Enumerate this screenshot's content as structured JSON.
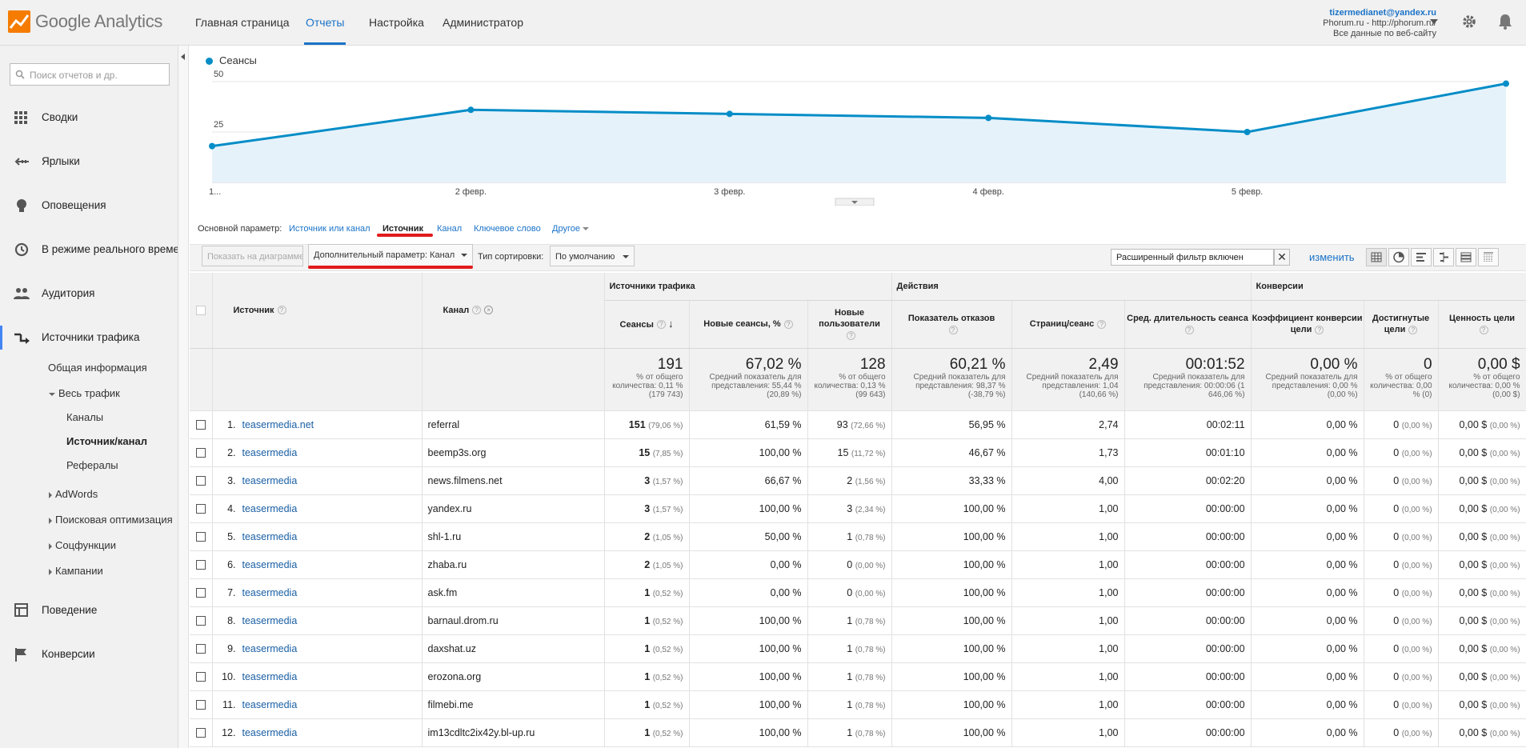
{
  "header": {
    "brand_google": "Google",
    "brand_analytics": "Analytics",
    "nav": [
      "Главная страница",
      "Отчеты",
      "Настройка",
      "Администратор"
    ],
    "active_nav": "Отчеты",
    "account_email": "tizermedianet@yandex.ru",
    "account_property": "Phorum.ru - http://phorum.ru/",
    "account_view": "Все данные по веб-сайту"
  },
  "sidebar": {
    "search_placeholder": "Поиск отчетов и др.",
    "items": [
      {
        "label": "Сводки",
        "icon": "grid-icon"
      },
      {
        "label": "Ярлыки",
        "icon": "shortcut-arrow-icon"
      },
      {
        "label": "Оповещения",
        "icon": "lightbulb-icon"
      },
      {
        "label": "В режиме реального времени",
        "icon": "clock-icon"
      },
      {
        "label": "Аудитория",
        "icon": "people-icon"
      },
      {
        "label": "Источники трафика",
        "icon": "traffic-arrows-icon"
      },
      {
        "label": "Поведение",
        "icon": "behavior-layout-icon"
      },
      {
        "label": "Конверсии",
        "icon": "flag-icon"
      }
    ],
    "sub": {
      "overview": "Общая информация",
      "all_traffic": "Весь трафик",
      "channels": "Каналы",
      "source_medium": "Источник/канал",
      "referrals": "Рефералы",
      "adwords": "AdWords",
      "seo": "Поисковая оптимизация",
      "social": "Соцфункции",
      "campaigns": "Кампании"
    }
  },
  "chart_data": {
    "type": "area",
    "series": [
      {
        "name": "Сеансы",
        "values": [
          18,
          36,
          34,
          32,
          25,
          49
        ]
      }
    ],
    "x": [
      "1...",
      "2 февр.",
      "3 февр.",
      "4 февр.",
      "5 февр.",
      ""
    ],
    "y_ticks": [
      "50",
      "25"
    ],
    "ylim": [
      0,
      50
    ],
    "color": "#058dc7"
  },
  "dimensions": {
    "label": "Основной параметр:",
    "options": [
      "Источник или канал",
      "Источник",
      "Канал",
      "Ключевое слово",
      "Другое"
    ],
    "active": "Источник"
  },
  "toolbar": {
    "plot_rows": "Показать на диаграмме",
    "secondary": "Дополнительный параметр: Канал",
    "sort_label": "Тип сортировки:",
    "sort_value": "По умолчанию",
    "filter_text": "Расширенный фильтр включен",
    "filter_clear": "✕",
    "change": "изменить"
  },
  "table": {
    "groups": {
      "traffic": "Источники трафика",
      "actions": "Действия",
      "conversions": "Конверсии"
    },
    "columns": {
      "source": "Источник",
      "medium": "Канал",
      "sessions": "Сеансы",
      "new_sessions": "Новые сеансы, %",
      "new_users": "Новые пользователи",
      "bounce": "Показатель отказов",
      "pages": "Страниц/сеанс",
      "duration": "Сред. длительность сеанса",
      "conv_rate": "Коэффициент конверсии цели",
      "completions": "Достигнутые цели",
      "value": "Ценность цели"
    },
    "totals": {
      "sessions": "191",
      "sessions_note": "% от общего количества: 0,11 % (179 743)",
      "new_sessions": "67,02 %",
      "new_sessions_note": "Средний показатель для представления: 55,44 % (20,89 %)",
      "new_users": "128",
      "new_users_note": "% от общего количества: 0,13 % (99 643)",
      "bounce": "60,21 %",
      "bounce_note": "Средний показатель для представления: 98,37 % (-38,79 %)",
      "pages": "2,49",
      "pages_note": "Средний показатель для представления: 1,04 (140,66 %)",
      "duration": "00:01:52",
      "duration_note": "Средний показатель для представления: 00:00:06 (1 646,06 %)",
      "conv_rate": "0,00 %",
      "conv_rate_note": "Средний показатель для представления: 0,00 % (0,00 %)",
      "completions": "0",
      "completions_note": "% от общего количества: 0,00 % (0)",
      "value": "0,00 $",
      "value_note": "% от общего количества: 0,00 % (0,00 $)"
    },
    "rows": [
      {
        "n": "1.",
        "source": "teasermedia.net",
        "medium": "referral",
        "sessions": "151",
        "sess_pct": "(79,06 %)",
        "new_sess": "61,59 %",
        "users": "93",
        "users_pct": "(72,66 %)",
        "bounce": "56,95 %",
        "pages": "2,74",
        "dur": "00:02:11",
        "conv": "0,00 %",
        "comp": "0",
        "comp_pct": "(0,00 %)",
        "val": "0,00 $",
        "val_pct": "(0,00 %)"
      },
      {
        "n": "2.",
        "source": "teasermedia",
        "medium": "beemp3s.org",
        "sessions": "15",
        "sess_pct": "(7,85 %)",
        "new_sess": "100,00 %",
        "users": "15",
        "users_pct": "(11,72 %)",
        "bounce": "46,67 %",
        "pages": "1,73",
        "dur": "00:01:10",
        "conv": "0,00 %",
        "comp": "0",
        "comp_pct": "(0,00 %)",
        "val": "0,00 $",
        "val_pct": "(0,00 %)"
      },
      {
        "n": "3.",
        "source": "teasermedia",
        "medium": "news.filmens.net",
        "sessions": "3",
        "sess_pct": "(1,57 %)",
        "new_sess": "66,67 %",
        "users": "2",
        "users_pct": "(1,56 %)",
        "bounce": "33,33 %",
        "pages": "4,00",
        "dur": "00:02:20",
        "conv": "0,00 %",
        "comp": "0",
        "comp_pct": "(0,00 %)",
        "val": "0,00 $",
        "val_pct": "(0,00 %)"
      },
      {
        "n": "4.",
        "source": "teasermedia",
        "medium": "yandex.ru",
        "sessions": "3",
        "sess_pct": "(1,57 %)",
        "new_sess": "100,00 %",
        "users": "3",
        "users_pct": "(2,34 %)",
        "bounce": "100,00 %",
        "pages": "1,00",
        "dur": "00:00:00",
        "conv": "0,00 %",
        "comp": "0",
        "comp_pct": "(0,00 %)",
        "val": "0,00 $",
        "val_pct": "(0,00 %)"
      },
      {
        "n": "5.",
        "source": "teasermedia",
        "medium": "shl-1.ru",
        "sessions": "2",
        "sess_pct": "(1,05 %)",
        "new_sess": "50,00 %",
        "users": "1",
        "users_pct": "(0,78 %)",
        "bounce": "100,00 %",
        "pages": "1,00",
        "dur": "00:00:00",
        "conv": "0,00 %",
        "comp": "0",
        "comp_pct": "(0,00 %)",
        "val": "0,00 $",
        "val_pct": "(0,00 %)"
      },
      {
        "n": "6.",
        "source": "teasermedia",
        "medium": "zhaba.ru",
        "sessions": "2",
        "sess_pct": "(1,05 %)",
        "new_sess": "0,00 %",
        "users": "0",
        "users_pct": "(0,00 %)",
        "bounce": "100,00 %",
        "pages": "1,00",
        "dur": "00:00:00",
        "conv": "0,00 %",
        "comp": "0",
        "comp_pct": "(0,00 %)",
        "val": "0,00 $",
        "val_pct": "(0,00 %)"
      },
      {
        "n": "7.",
        "source": "teasermedia",
        "medium": "ask.fm",
        "sessions": "1",
        "sess_pct": "(0,52 %)",
        "new_sess": "0,00 %",
        "users": "0",
        "users_pct": "(0,00 %)",
        "bounce": "100,00 %",
        "pages": "1,00",
        "dur": "00:00:00",
        "conv": "0,00 %",
        "comp": "0",
        "comp_pct": "(0,00 %)",
        "val": "0,00 $",
        "val_pct": "(0,00 %)"
      },
      {
        "n": "8.",
        "source": "teasermedia",
        "medium": "barnaul.drom.ru",
        "sessions": "1",
        "sess_pct": "(0,52 %)",
        "new_sess": "100,00 %",
        "users": "1",
        "users_pct": "(0,78 %)",
        "bounce": "100,00 %",
        "pages": "1,00",
        "dur": "00:00:00",
        "conv": "0,00 %",
        "comp": "0",
        "comp_pct": "(0,00 %)",
        "val": "0,00 $",
        "val_pct": "(0,00 %)"
      },
      {
        "n": "9.",
        "source": "teasermedia",
        "medium": "daxshat.uz",
        "sessions": "1",
        "sess_pct": "(0,52 %)",
        "new_sess": "100,00 %",
        "users": "1",
        "users_pct": "(0,78 %)",
        "bounce": "100,00 %",
        "pages": "1,00",
        "dur": "00:00:00",
        "conv": "0,00 %",
        "comp": "0",
        "comp_pct": "(0,00 %)",
        "val": "0,00 $",
        "val_pct": "(0,00 %)"
      },
      {
        "n": "10.",
        "source": "teasermedia",
        "medium": "erozona.org",
        "sessions": "1",
        "sess_pct": "(0,52 %)",
        "new_sess": "100,00 %",
        "users": "1",
        "users_pct": "(0,78 %)",
        "bounce": "100,00 %",
        "pages": "1,00",
        "dur": "00:00:00",
        "conv": "0,00 %",
        "comp": "0",
        "comp_pct": "(0,00 %)",
        "val": "0,00 $",
        "val_pct": "(0,00 %)"
      },
      {
        "n": "11.",
        "source": "teasermedia",
        "medium": "filmebi.me",
        "sessions": "1",
        "sess_pct": "(0,52 %)",
        "new_sess": "100,00 %",
        "users": "1",
        "users_pct": "(0,78 %)",
        "bounce": "100,00 %",
        "pages": "1,00",
        "dur": "00:00:00",
        "conv": "0,00 %",
        "comp": "0",
        "comp_pct": "(0,00 %)",
        "val": "0,00 $",
        "val_pct": "(0,00 %)"
      },
      {
        "n": "12.",
        "source": "teasermedia",
        "medium": "im13cdltc2ix42y.bl-up.ru",
        "sessions": "1",
        "sess_pct": "(0,52 %)",
        "new_sess": "100,00 %",
        "users": "1",
        "users_pct": "(0,78 %)",
        "bounce": "100,00 %",
        "pages": "1,00",
        "dur": "00:00:00",
        "conv": "0,00 %",
        "comp": "0",
        "comp_pct": "(0,00 %)",
        "val": "0,00 $",
        "val_pct": "(0,00 %)"
      }
    ]
  }
}
